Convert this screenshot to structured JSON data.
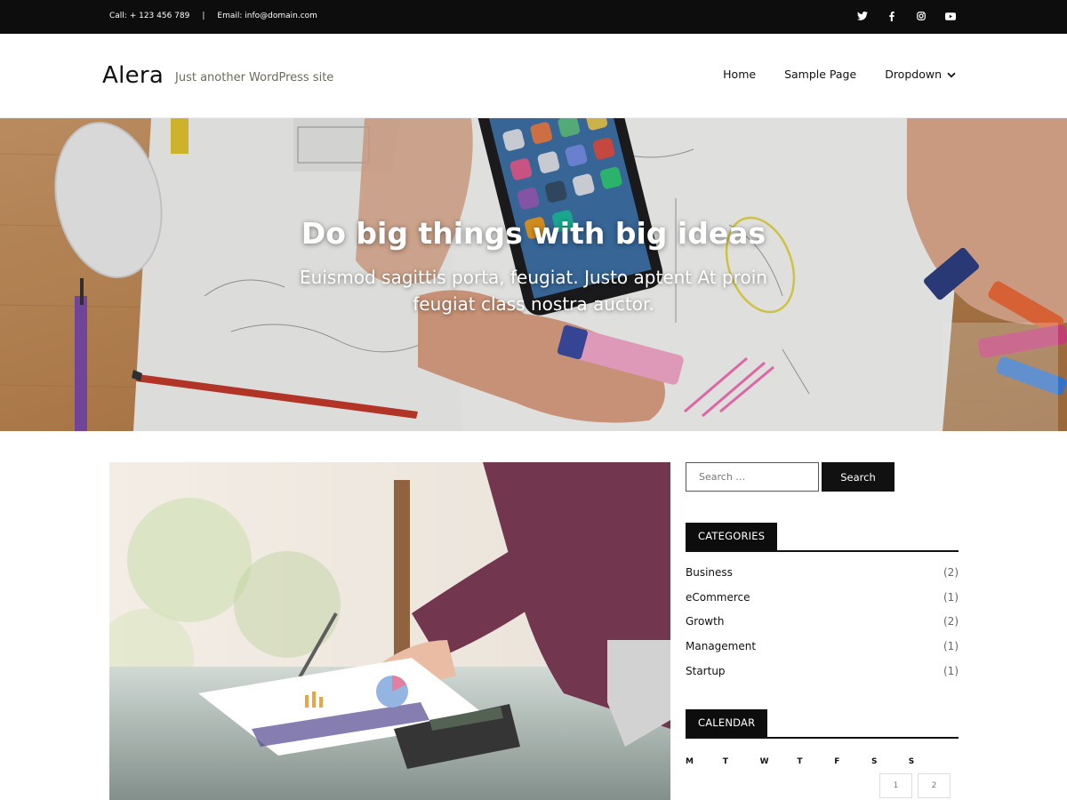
{
  "topbar": {
    "phone": "Call: + 123 456 789",
    "separator": "|",
    "email": "Email: info@domain.com",
    "social": [
      "twitter-icon",
      "facebook-icon",
      "instagram-icon",
      "youtube-icon"
    ]
  },
  "header": {
    "site_title": "Alera",
    "tagline": "Just another WordPress site",
    "nav": [
      {
        "label": "Home"
      },
      {
        "label": "Sample Page"
      },
      {
        "label": "Dropdown",
        "icon": "chevron-down-icon"
      }
    ]
  },
  "hero": {
    "title": "Do big things with big ideas",
    "subtitle": "Euismod sagittis porta, feugiat. Justo aptent At proin feugiat class nostra auctor."
  },
  "sidebar": {
    "search": {
      "placeholder": "Search …",
      "button_label": "Search"
    },
    "categories": {
      "heading": "CATEGORIES",
      "items": [
        {
          "name": "Business",
          "count": "(2)"
        },
        {
          "name": "eCommerce",
          "count": "(1)"
        },
        {
          "name": "Growth",
          "count": "(2)"
        },
        {
          "name": "Management",
          "count": "(1)"
        },
        {
          "name": "Startup",
          "count": "(1)"
        }
      ]
    },
    "calendar": {
      "heading": "CALENDAR",
      "weekdays": [
        "M",
        "T",
        "W",
        "T",
        "F",
        "S",
        "S"
      ],
      "dates": [
        "1",
        "2"
      ]
    }
  },
  "colors": {
    "topbar_bg": "#0d0d0d",
    "accent": "#111111",
    "tagline": "#6b6b5c"
  }
}
